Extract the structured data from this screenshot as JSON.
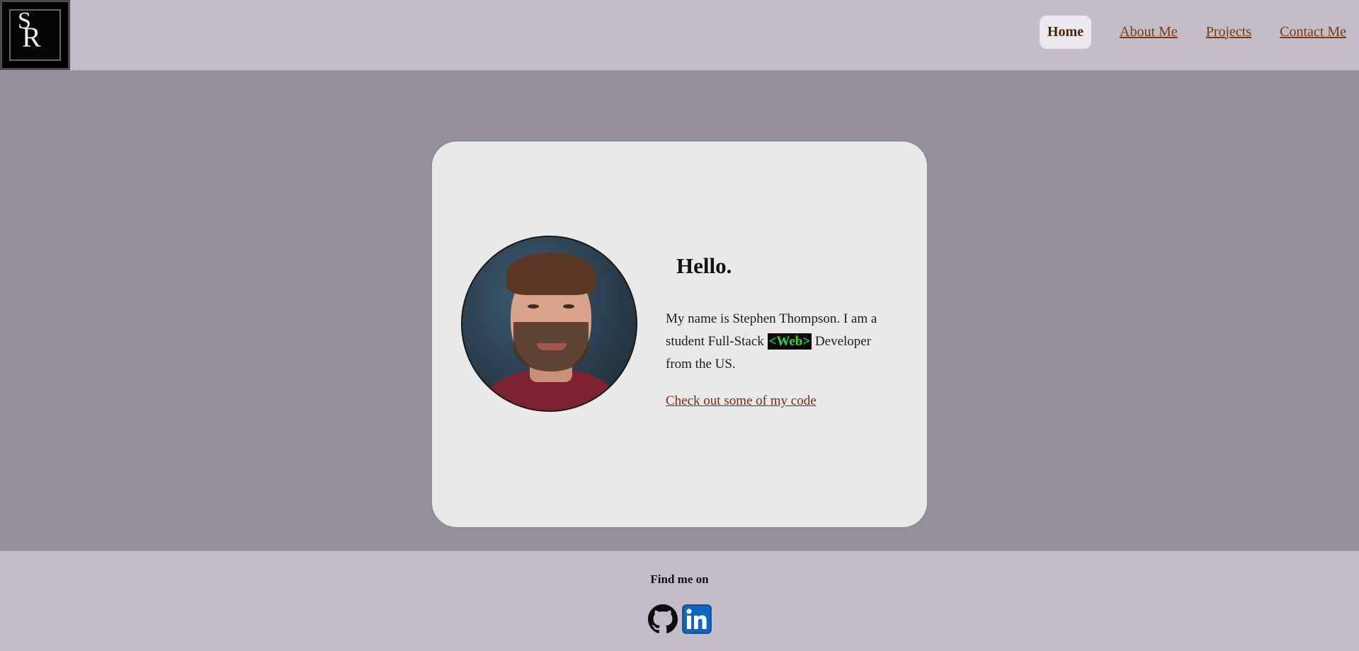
{
  "logo": {
    "letters": "SR",
    "icon": "monogram-logo-icon"
  },
  "nav": {
    "home": "Home",
    "about": "About Me",
    "projects": "Projects",
    "contact": "Contact Me"
  },
  "hero": {
    "greeting": "Hello.",
    "intro_before": "My name is Stephen Thompson. I am a student Full-Stack ",
    "intro_tag": "<Web>",
    "intro_after": " Developer from the US.",
    "code_link": "Check out some of my code"
  },
  "footer": {
    "find_me": "Find me on",
    "social": [
      {
        "name": "GitHub",
        "icon": "github-icon"
      },
      {
        "name": "LinkedIn",
        "icon": "linkedin-icon"
      }
    ]
  },
  "colors": {
    "header_bg": "#c3bdca",
    "page_bg": "#958e9d",
    "card_bg": "#e9e9e9",
    "link": "#7a3b14",
    "web_tag_text": "#33d633",
    "linkedin_blue": "#0a66c2"
  }
}
